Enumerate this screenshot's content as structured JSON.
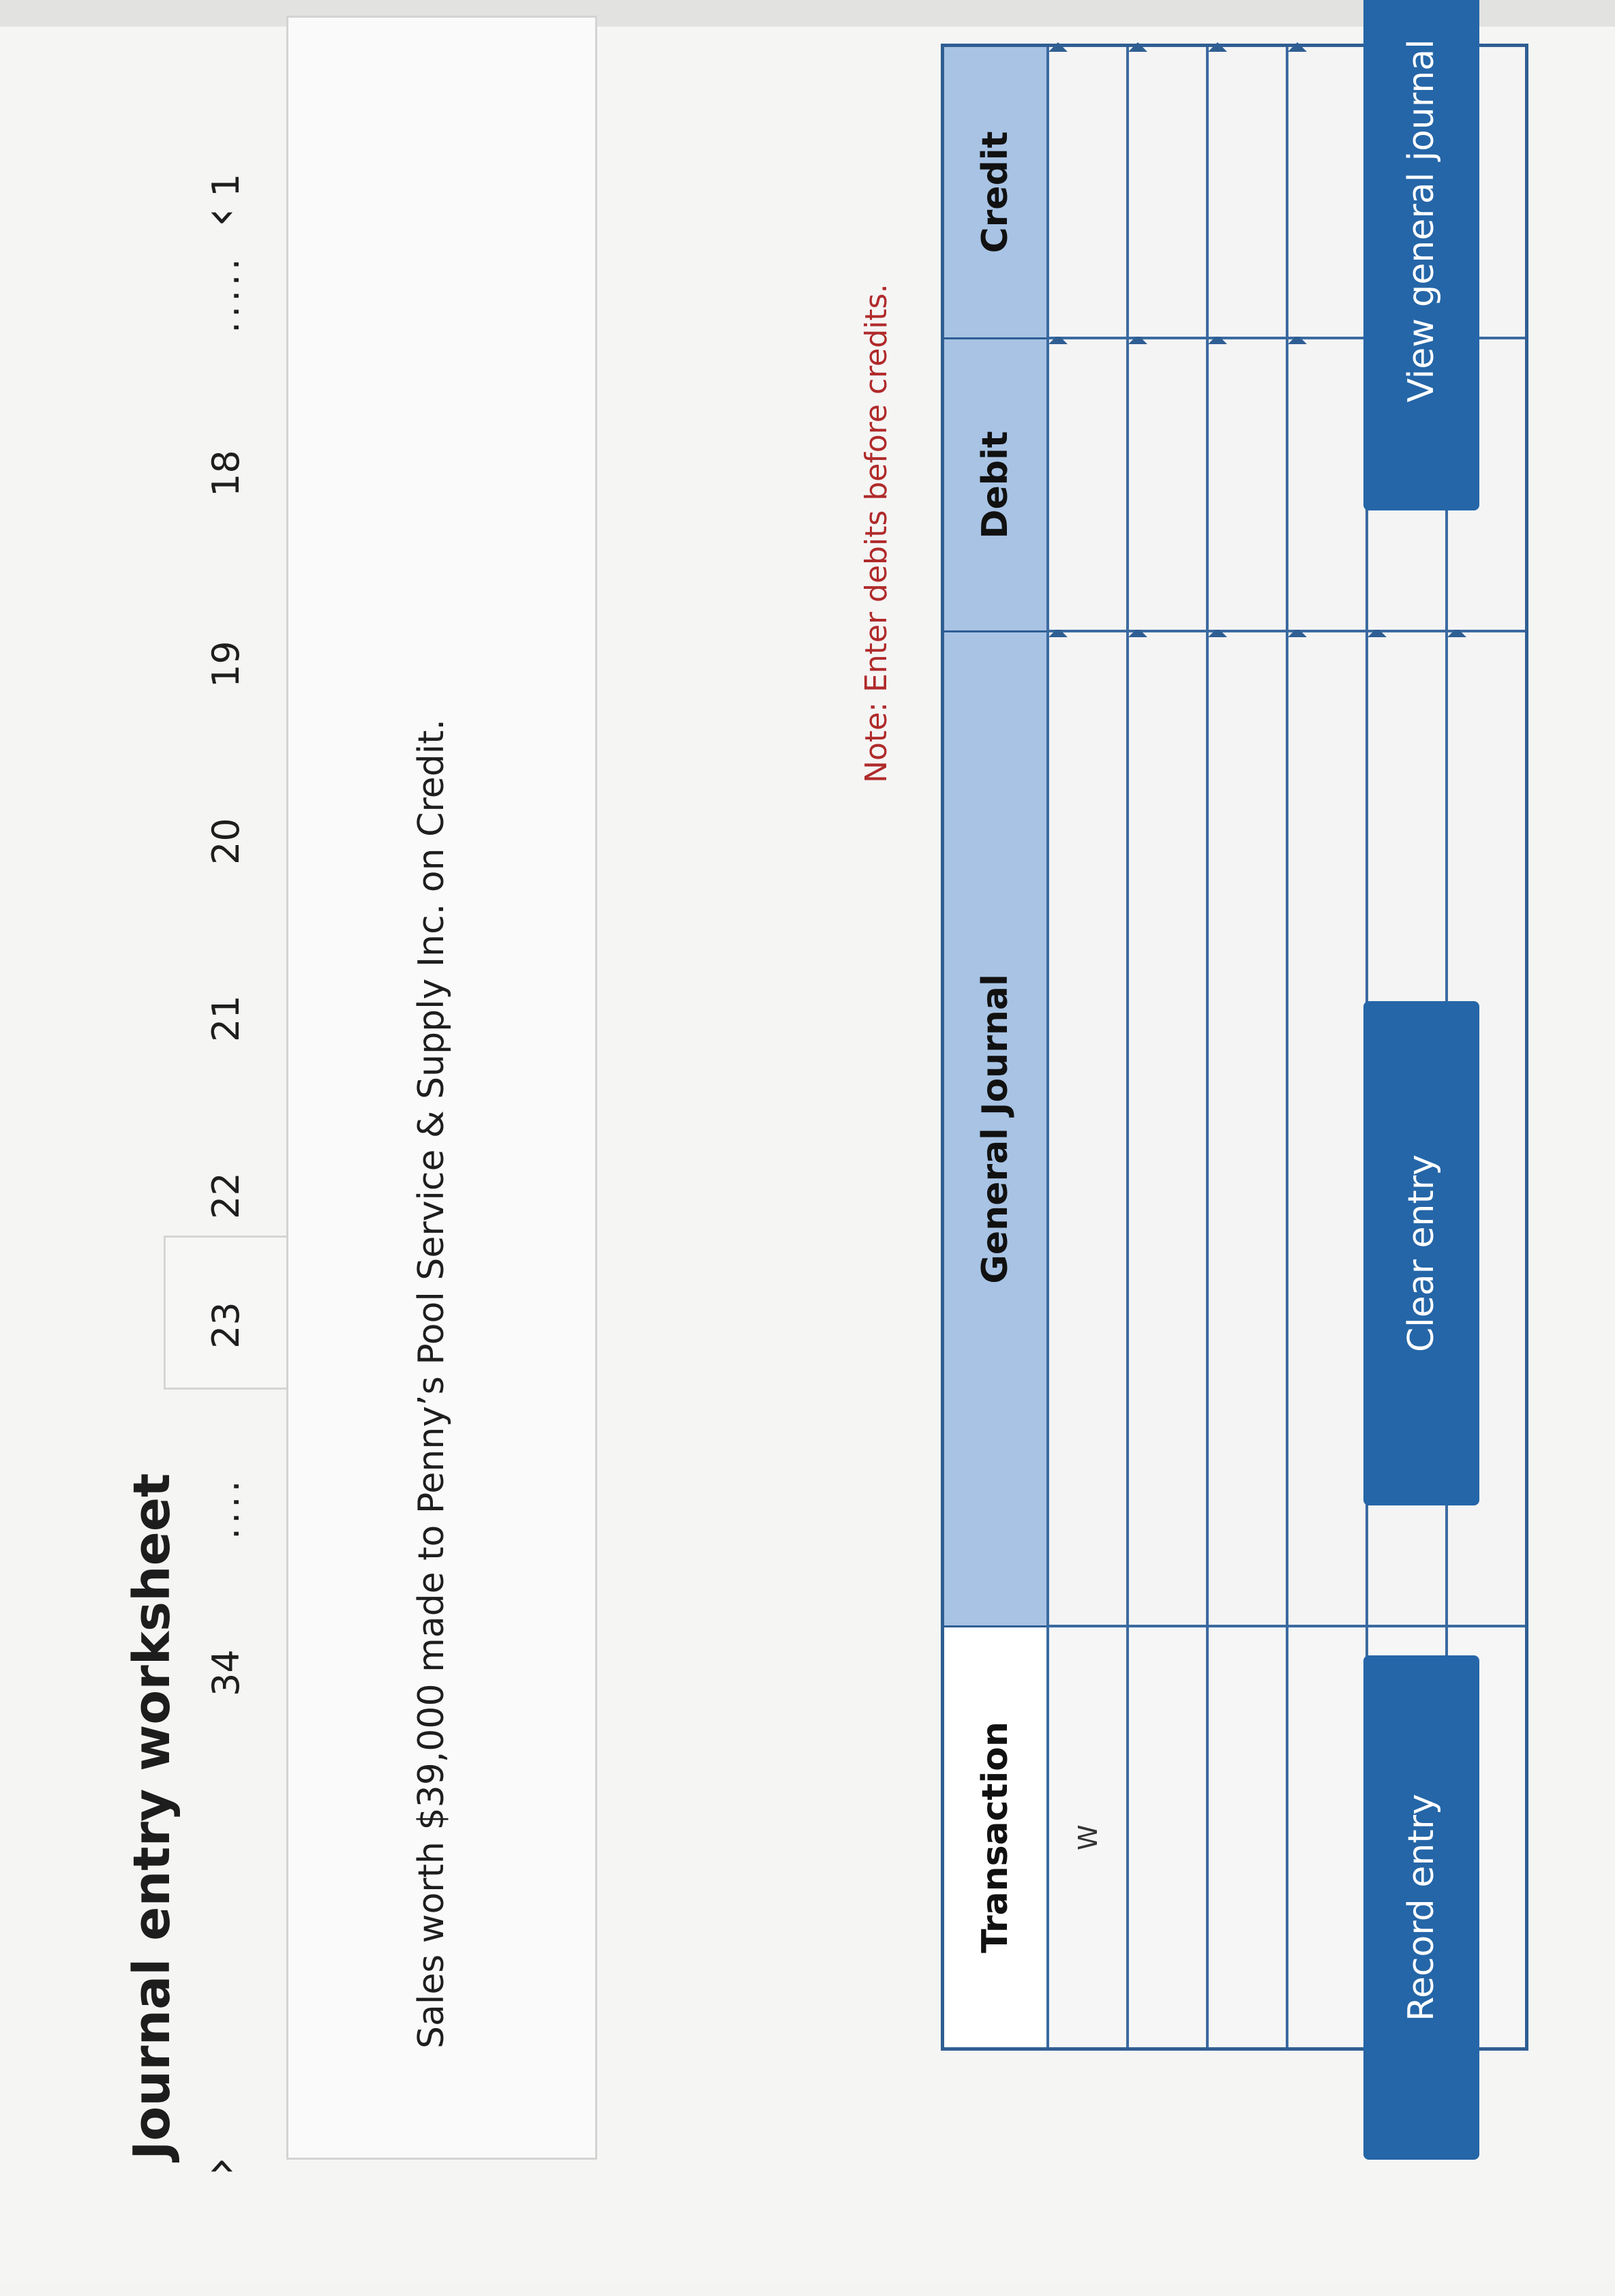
{
  "header": {
    "title": "Journal entry worksheet"
  },
  "pagination": {
    "prev_icon": "‹",
    "next_icon": "›",
    "items": [
      {
        "label": "1"
      },
      {
        "label": "....."
      },
      {
        "label": "18"
      },
      {
        "label": "19"
      },
      {
        "label": "20"
      },
      {
        "label": "21"
      },
      {
        "label": "22"
      },
      {
        "label": "23"
      },
      {
        "label": "...."
      },
      {
        "label": "34"
      }
    ],
    "active": "23"
  },
  "question": {
    "text": "Sales worth $39,000 made to Penny’s Pool Service & Supply Inc. on Credit."
  },
  "note": {
    "text": "Note: Enter debits before credits."
  },
  "journal": {
    "headers": {
      "transaction": "Transaction",
      "general_journal": "General Journal",
      "debit": "Debit",
      "credit": "Credit"
    },
    "rows": [
      {
        "transaction": "W"
      },
      {
        "transaction": ""
      },
      {
        "transaction": ""
      },
      {
        "transaction": ""
      },
      {
        "transaction": ""
      },
      {
        "transaction": ""
      }
    ]
  },
  "buttons": {
    "record": "Record entry",
    "clear": "Clear entry",
    "view": "View general journal"
  },
  "colors": {
    "accent": "#2566a8",
    "header_bg": "#a8c3e4",
    "note": "#b02a2a"
  }
}
